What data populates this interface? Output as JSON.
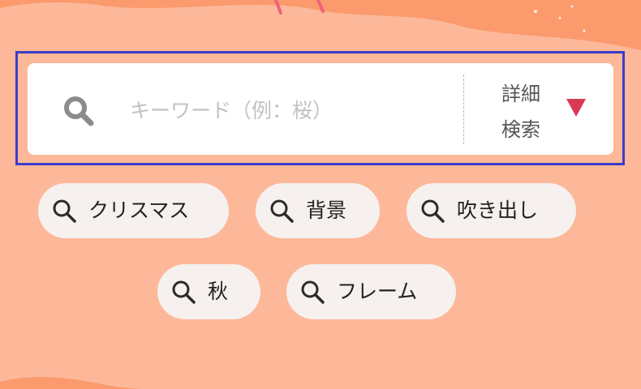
{
  "search": {
    "placeholder": "キーワード（例：桜）",
    "advanced_line1": "詳細",
    "advanced_line2": "検索",
    "search_icon": "search-icon",
    "dropdown_icon": "triangle-down-icon"
  },
  "tags": [
    {
      "label": "クリスマス",
      "icon": "search-icon"
    },
    {
      "label": "背景",
      "icon": "search-icon"
    },
    {
      "label": "吹き出し",
      "icon": "search-icon"
    },
    {
      "label": "秋",
      "icon": "search-icon"
    },
    {
      "label": "フレーム",
      "icon": "search-icon"
    }
  ],
  "colors": {
    "background": "#fdb89a",
    "wave": "#fb9a6c",
    "highlight_border": "#3b3cc8",
    "dropdown_triangle": "#d83a52",
    "chip_background": "#f6f1ee"
  }
}
